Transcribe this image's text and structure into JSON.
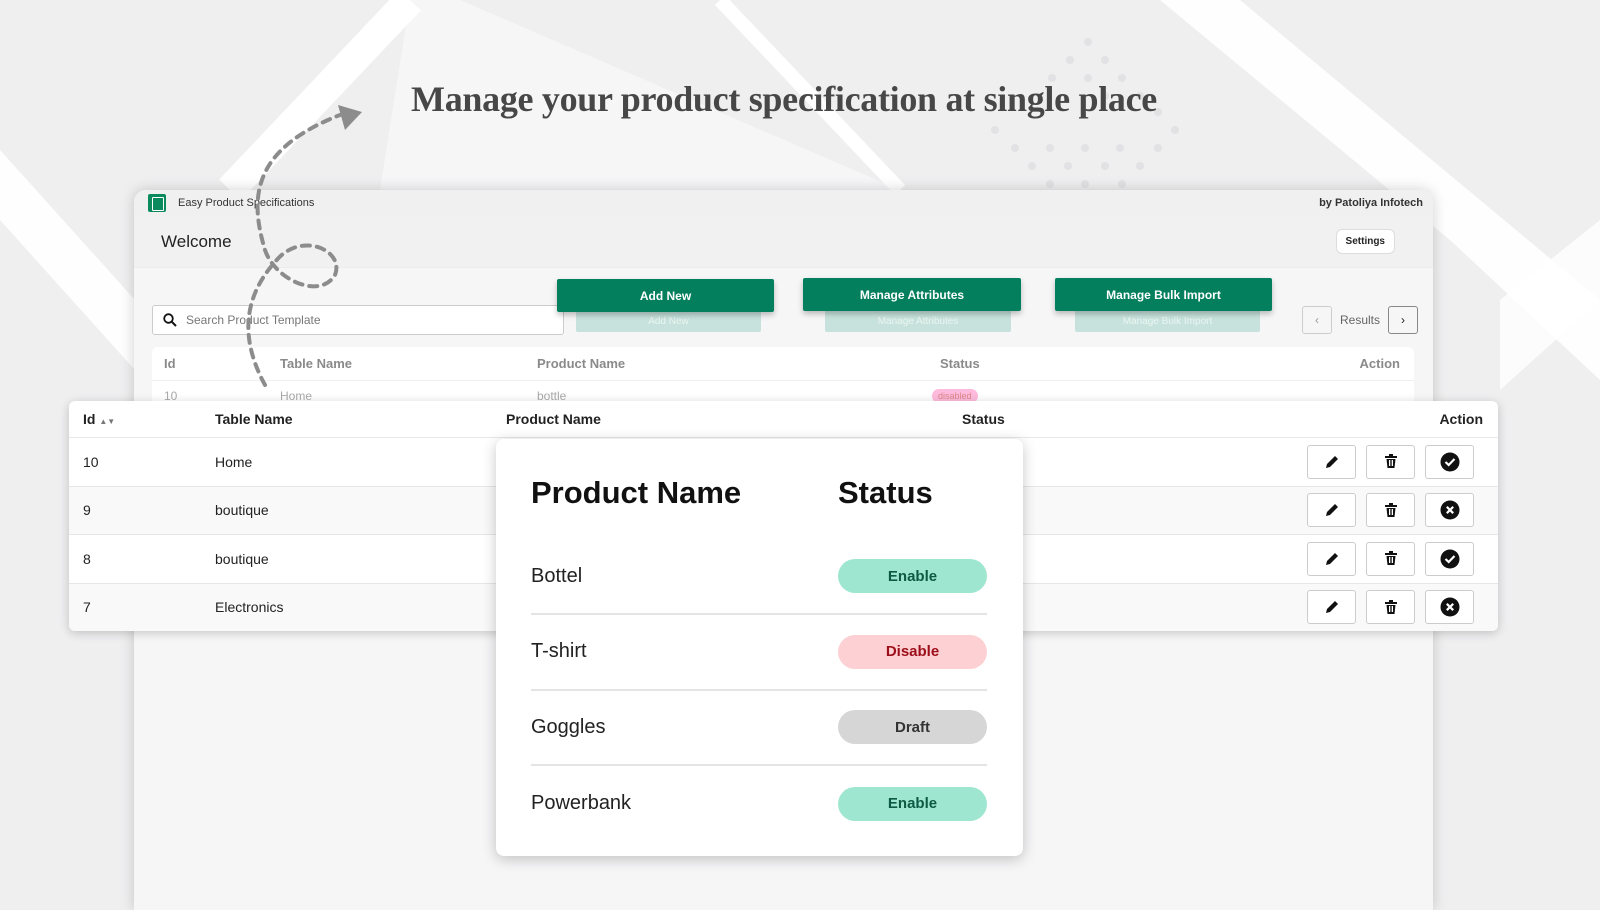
{
  "headline": "Manage your product specification at single place",
  "app": {
    "title": "Easy Product Specifications",
    "vendor": "by Patoliya Infotech",
    "welcome": "Welcome",
    "settings_label": "Settings"
  },
  "toolbar": {
    "search_placeholder": "Search Product Template",
    "add_new": "Add New",
    "manage_attributes": "Manage Attributes",
    "manage_bulk_import": "Manage Bulk Import",
    "results_label": "Results"
  },
  "columns": {
    "id": "Id",
    "table_name": "Table Name",
    "product_name": "Product Name",
    "status": "Status",
    "action": "Action"
  },
  "background_row": {
    "id": "10",
    "table_name": "Home",
    "product_name": "bottle",
    "status": "disabled"
  },
  "rows": [
    {
      "id": "10",
      "table_name": "Home",
      "active": true
    },
    {
      "id": "9",
      "table_name": "boutique",
      "active": false
    },
    {
      "id": "8",
      "table_name": "boutique",
      "active": true
    },
    {
      "id": "7",
      "table_name": "Electronics",
      "active": false
    }
  ],
  "card": {
    "header_product": "Product Name",
    "header_status": "Status",
    "items": [
      {
        "name": "Bottel",
        "status": "Enable",
        "bg": "#9fe6d0",
        "color": "#0c5a44"
      },
      {
        "name": "T-shirt",
        "status": "Disable",
        "bg": "#fdd0d3",
        "color": "#9c0f1a"
      },
      {
        "name": "Goggles",
        "status": "Draft",
        "bg": "#d6d6d6",
        "color": "#333333"
      },
      {
        "name": "Powerbank",
        "status": "Enable",
        "bg": "#9fe6d0",
        "color": "#0c5a44"
      }
    ]
  },
  "colors": {
    "brand": "#047f5e"
  }
}
